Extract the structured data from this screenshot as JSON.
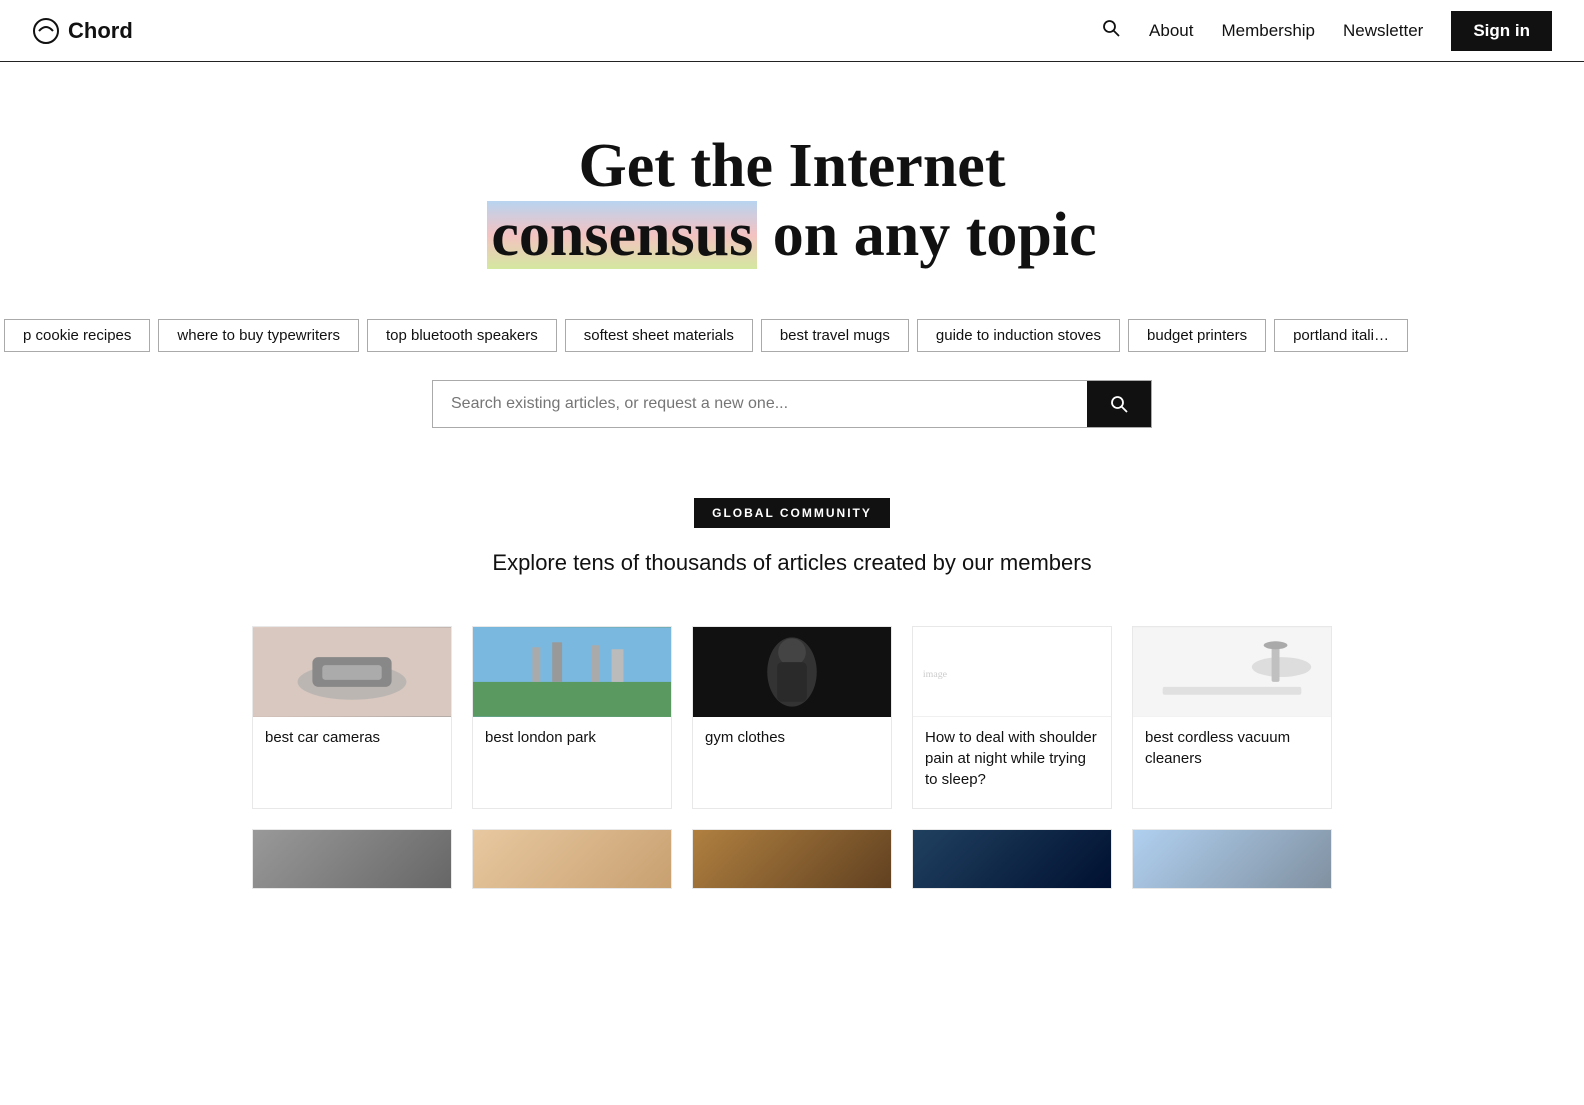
{
  "nav": {
    "logo_text": "Chord",
    "about_label": "About",
    "membership_label": "Membership",
    "newsletter_label": "Newsletter",
    "signin_label": "Sign in"
  },
  "hero": {
    "line1": "Get the Internet",
    "line2_pre": "",
    "consensus_word": "consensus",
    "line2_post": " on any topic"
  },
  "tags": [
    "p cookie recipes",
    "where to buy typewriters",
    "top bluetooth speakers",
    "softest sheet materials",
    "best travel mugs",
    "guide to induction stoves",
    "budget printers",
    "portland itali…"
  ],
  "search": {
    "placeholder": "Search existing articles, or request a new one..."
  },
  "community": {
    "badge": "GLOBAL COMMUNITY",
    "subtitle": "Explore tens of thousands of articles created by our members"
  },
  "articles_row1": [
    {
      "title": "best car cameras",
      "thumb_class": "thumb-car"
    },
    {
      "title": "best london park",
      "thumb_class": "thumb-london"
    },
    {
      "title": "gym clothes",
      "thumb_class": "thumb-gym"
    },
    {
      "title": "How to deal with shoulder pain at night while trying to sleep?",
      "thumb_class": "thumb-shoulder"
    },
    {
      "title": "best cordless vacuum cleaners",
      "thumb_class": "thumb-vacuum"
    }
  ],
  "articles_row2": [
    {
      "title": "",
      "thumb_class": "thumb-oven"
    },
    {
      "title": "",
      "thumb_class": "thumb-donuts"
    },
    {
      "title": "",
      "thumb_class": "thumb-restaurant"
    },
    {
      "title": "",
      "thumb_class": "thumb-lights"
    },
    {
      "title": "",
      "thumb_class": "thumb-mountains"
    }
  ]
}
